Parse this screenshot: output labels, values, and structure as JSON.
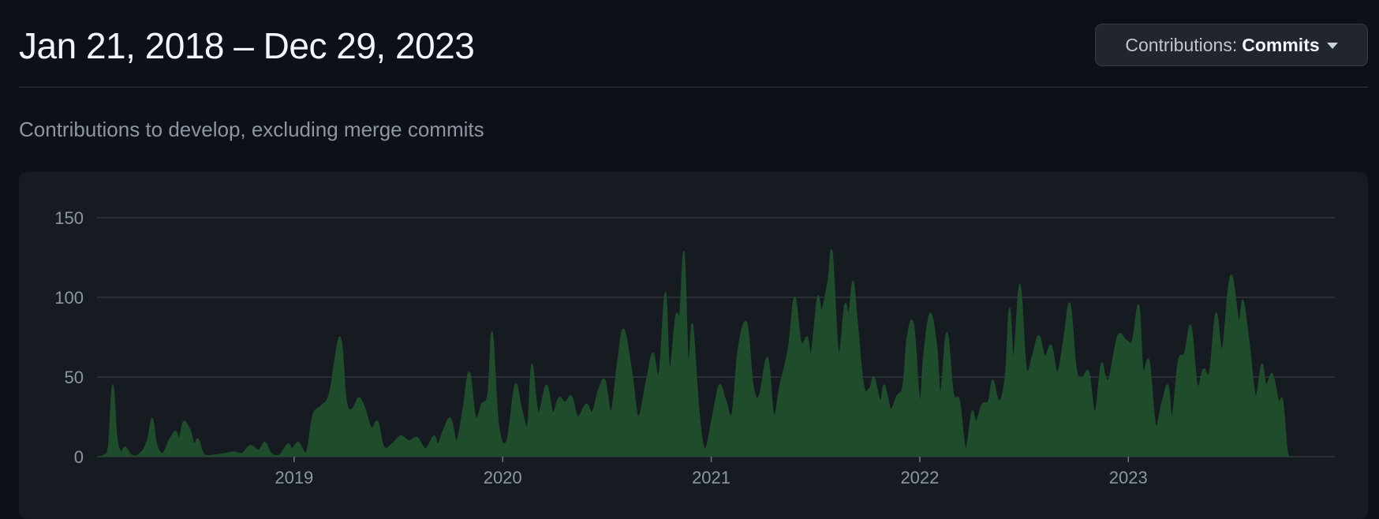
{
  "header": {
    "date_range": "Jan 21, 2018 – Dec 29, 2023",
    "contributions_prefix": "Contributions:",
    "contributions_value": "Commits"
  },
  "subtitle": "Contributions to develop, excluding merge commits",
  "colors": {
    "background": "#0d1117",
    "panel": "#161b22",
    "area_fill": "#1f4d2b",
    "area_stroke": "#2ea043",
    "grid": "#30363d"
  },
  "chart_data": {
    "type": "area",
    "title": "",
    "xlabel": "",
    "ylabel": "",
    "ylim": [
      0,
      150
    ],
    "yticks": [
      0,
      50,
      100,
      150
    ],
    "xlim": [
      2018.055,
      2023.99
    ],
    "xticks": [
      {
        "x": 2019,
        "label": "2019"
      },
      {
        "x": 2020,
        "label": "2020"
      },
      {
        "x": 2021,
        "label": "2021"
      },
      {
        "x": 2022,
        "label": "2022"
      },
      {
        "x": 2023,
        "label": "2023"
      }
    ],
    "grid": true,
    "series": [
      {
        "points": [
          [
            2018.06,
            0
          ],
          [
            2018.09,
            1
          ],
          [
            2018.11,
            6
          ],
          [
            2018.13,
            45
          ],
          [
            2018.15,
            12
          ],
          [
            2018.17,
            3
          ],
          [
            2018.19,
            6
          ],
          [
            2018.22,
            1
          ],
          [
            2018.25,
            1
          ],
          [
            2018.28,
            5
          ],
          [
            2018.3,
            12
          ],
          [
            2018.32,
            24
          ],
          [
            2018.34,
            8
          ],
          [
            2018.37,
            2
          ],
          [
            2018.4,
            10
          ],
          [
            2018.43,
            16
          ],
          [
            2018.45,
            12
          ],
          [
            2018.47,
            22
          ],
          [
            2018.5,
            17
          ],
          [
            2018.52,
            8
          ],
          [
            2018.54,
            11
          ],
          [
            2018.57,
            1
          ],
          [
            2018.62,
            1
          ],
          [
            2018.67,
            2
          ],
          [
            2018.71,
            3
          ],
          [
            2018.75,
            2
          ],
          [
            2018.79,
            7
          ],
          [
            2018.83,
            4
          ],
          [
            2018.86,
            9
          ],
          [
            2018.89,
            2
          ],
          [
            2018.93,
            1
          ],
          [
            2018.97,
            8
          ],
          [
            2018.99,
            5
          ],
          [
            2019.02,
            9
          ],
          [
            2019.06,
            3
          ],
          [
            2019.09,
            26
          ],
          [
            2019.13,
            32
          ],
          [
            2019.17,
            40
          ],
          [
            2019.22,
            75
          ],
          [
            2019.25,
            35
          ],
          [
            2019.28,
            30
          ],
          [
            2019.31,
            37
          ],
          [
            2019.34,
            30
          ],
          [
            2019.37,
            18
          ],
          [
            2019.4,
            22
          ],
          [
            2019.43,
            6
          ],
          [
            2019.47,
            8
          ],
          [
            2019.51,
            13
          ],
          [
            2019.55,
            10
          ],
          [
            2019.59,
            12
          ],
          [
            2019.63,
            5
          ],
          [
            2019.67,
            13
          ],
          [
            2019.69,
            8
          ],
          [
            2019.72,
            18
          ],
          [
            2019.75,
            24
          ],
          [
            2019.78,
            10
          ],
          [
            2019.81,
            30
          ],
          [
            2019.84,
            53
          ],
          [
            2019.87,
            25
          ],
          [
            2019.9,
            33
          ],
          [
            2019.93,
            40
          ],
          [
            2019.95,
            78
          ],
          [
            2019.98,
            20
          ],
          [
            2020.02,
            10
          ],
          [
            2020.06,
            45
          ],
          [
            2020.09,
            30
          ],
          [
            2020.12,
            20
          ],
          [
            2020.14,
            58
          ],
          [
            2020.17,
            28
          ],
          [
            2020.21,
            45
          ],
          [
            2020.24,
            28
          ],
          [
            2020.27,
            37
          ],
          [
            2020.3,
            34
          ],
          [
            2020.33,
            38
          ],
          [
            2020.36,
            25
          ],
          [
            2020.4,
            33
          ],
          [
            2020.43,
            28
          ],
          [
            2020.46,
            42
          ],
          [
            2020.49,
            48
          ],
          [
            2020.52,
            28
          ],
          [
            2020.55,
            58
          ],
          [
            2020.58,
            80
          ],
          [
            2020.62,
            52
          ],
          [
            2020.65,
            25
          ],
          [
            2020.69,
            48
          ],
          [
            2020.72,
            65
          ],
          [
            2020.75,
            52
          ],
          [
            2020.78,
            103
          ],
          [
            2020.8,
            55
          ],
          [
            2020.83,
            88
          ],
          [
            2020.85,
            90
          ],
          [
            2020.87,
            128
          ],
          [
            2020.89,
            58
          ],
          [
            2020.91,
            83
          ],
          [
            2020.94,
            30
          ],
          [
            2020.97,
            5
          ],
          [
            2021.01,
            28
          ],
          [
            2021.04,
            45
          ],
          [
            2021.07,
            35
          ],
          [
            2021.1,
            27
          ],
          [
            2021.13,
            68
          ],
          [
            2021.17,
            84
          ],
          [
            2021.2,
            45
          ],
          [
            2021.23,
            38
          ],
          [
            2021.27,
            62
          ],
          [
            2021.3,
            26
          ],
          [
            2021.33,
            45
          ],
          [
            2021.37,
            68
          ],
          [
            2021.4,
            100
          ],
          [
            2021.43,
            72
          ],
          [
            2021.46,
            75
          ],
          [
            2021.48,
            65
          ],
          [
            2021.51,
            100
          ],
          [
            2021.53,
            92
          ],
          [
            2021.56,
            110
          ],
          [
            2021.58,
            128
          ],
          [
            2021.61,
            65
          ],
          [
            2021.64,
            95
          ],
          [
            2021.66,
            90
          ],
          [
            2021.68,
            110
          ],
          [
            2021.7,
            85
          ],
          [
            2021.73,
            45
          ],
          [
            2021.76,
            43
          ],
          [
            2021.78,
            50
          ],
          [
            2021.81,
            35
          ],
          [
            2021.83,
            45
          ],
          [
            2021.86,
            30
          ],
          [
            2021.89,
            38
          ],
          [
            2021.92,
            45
          ],
          [
            2021.94,
            75
          ],
          [
            2021.97,
            83
          ],
          [
            2022.0,
            35
          ],
          [
            2022.02,
            65
          ],
          [
            2022.05,
            90
          ],
          [
            2022.08,
            70
          ],
          [
            2022.1,
            40
          ],
          [
            2022.13,
            78
          ],
          [
            2022.16,
            40
          ],
          [
            2022.19,
            35
          ],
          [
            2022.22,
            5
          ],
          [
            2022.25,
            28
          ],
          [
            2022.27,
            22
          ],
          [
            2022.3,
            33
          ],
          [
            2022.33,
            35
          ],
          [
            2022.35,
            48
          ],
          [
            2022.38,
            35
          ],
          [
            2022.41,
            50
          ],
          [
            2022.43,
            93
          ],
          [
            2022.45,
            62
          ],
          [
            2022.48,
            108
          ],
          [
            2022.51,
            56
          ],
          [
            2022.54,
            63
          ],
          [
            2022.57,
            76
          ],
          [
            2022.6,
            63
          ],
          [
            2022.63,
            70
          ],
          [
            2022.66,
            53
          ],
          [
            2022.69,
            73
          ],
          [
            2022.72,
            96
          ],
          [
            2022.75,
            55
          ],
          [
            2022.78,
            50
          ],
          [
            2022.81,
            53
          ],
          [
            2022.84,
            28
          ],
          [
            2022.87,
            58
          ],
          [
            2022.89,
            50
          ],
          [
            2022.91,
            50
          ],
          [
            2022.95,
            76
          ],
          [
            2022.99,
            73
          ],
          [
            2023.02,
            73
          ],
          [
            2023.05,
            95
          ],
          [
            2023.07,
            55
          ],
          [
            2023.1,
            60
          ],
          [
            2023.13,
            20
          ],
          [
            2023.16,
            33
          ],
          [
            2023.19,
            45
          ],
          [
            2023.21,
            25
          ],
          [
            2023.24,
            60
          ],
          [
            2023.27,
            65
          ],
          [
            2023.3,
            82
          ],
          [
            2023.33,
            45
          ],
          [
            2023.36,
            55
          ],
          [
            2023.39,
            53
          ],
          [
            2023.42,
            90
          ],
          [
            2023.45,
            67
          ],
          [
            2023.48,
            106
          ],
          [
            2023.5,
            112
          ],
          [
            2023.53,
            85
          ],
          [
            2023.55,
            98
          ],
          [
            2023.58,
            70
          ],
          [
            2023.61,
            38
          ],
          [
            2023.64,
            58
          ],
          [
            2023.66,
            45
          ],
          [
            2023.69,
            52
          ],
          [
            2023.72,
            35
          ],
          [
            2023.74,
            35
          ],
          [
            2023.76,
            5
          ],
          [
            2023.77,
            0
          ]
        ]
      }
    ]
  }
}
